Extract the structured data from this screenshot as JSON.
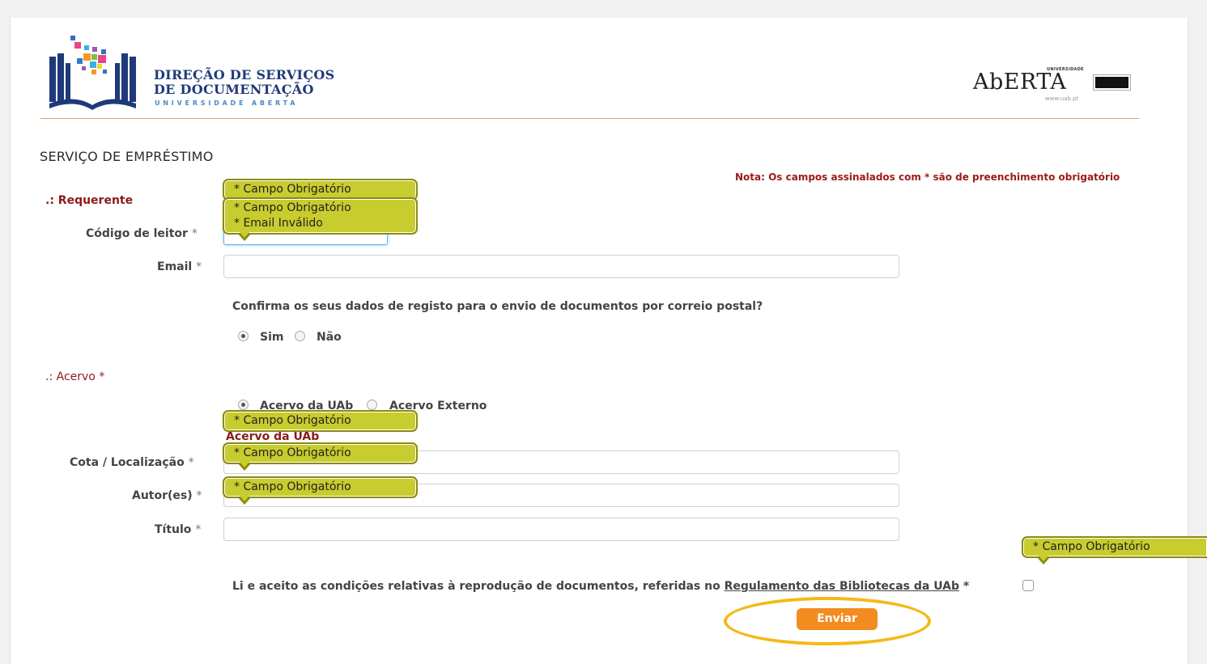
{
  "header": {
    "logo_title_line1": "DIREÇÃO DE SERVIÇOS",
    "logo_title_line2": "DE DOCUMENTAÇÃO",
    "logo_subtitle": "UNIVERSIDADE ABERTA",
    "aberta_univ": "UNIVERSIDADE",
    "aberta_text": "AbERTA",
    "aberta_url": "www.uab.pt"
  },
  "page_title": "SERVIÇO DE EMPRÉSTIMO",
  "note": "Nota: Os campos assinalados com * são de preenchimento obrigatório",
  "requerente": {
    "section_label": ".: Requerente",
    "codigo_label": "Código de leitor",
    "email_label": "Email",
    "required_mark": "*",
    "confirm_question": "Confirma os seus dados de registo para o envio de documentos por correio postal?",
    "radio_sim": "Sim",
    "radio_nao": "Não",
    "selected": "Sim"
  },
  "acervo": {
    "section_label": ".: Acervo *",
    "radio_uab": "Acervo da UAb",
    "radio_externo": "Acervo Externo",
    "selected": "Acervo da UAb",
    "subsection": "Acervo da UAb",
    "cota_label": "Cota / Localização",
    "autor_label": "Autor(es)",
    "titulo_label": "Título"
  },
  "tooltips": {
    "required": "* Campo Obrigatório",
    "invalid_email": "* Email Inválido"
  },
  "agreement": {
    "text_before": "Li e aceito as condições relativas à reprodução de documentos, referidas no ",
    "link": "Regulamento das Bibliotecas da UAb",
    "text_after": " *"
  },
  "submit_label": "Enviar",
  "colors": {
    "accent_orange": "#f28c1f",
    "label_red": "#8b1a1a",
    "tooltip_yellow": "#c8cc2e",
    "highlight": "#f4b914"
  }
}
